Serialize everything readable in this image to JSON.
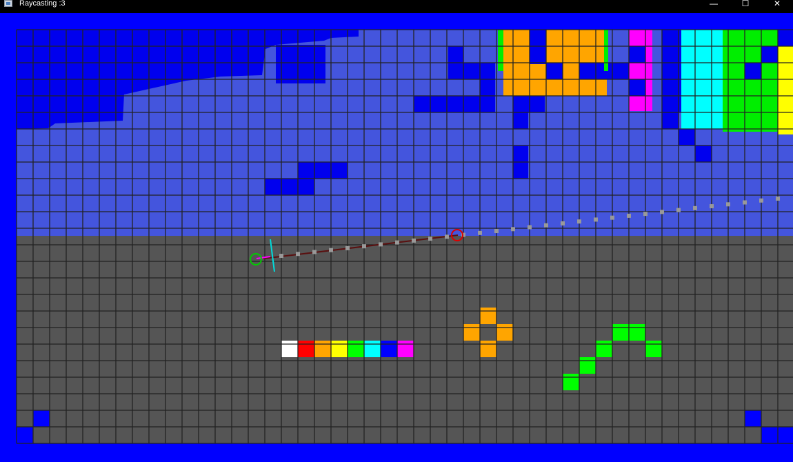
{
  "window": {
    "title": "Raycasting :3",
    "minimize_glyph": "—",
    "maximize_glyph": "☐",
    "close_glyph": "✕"
  },
  "icons": {
    "app": "app-window-icon",
    "minimize": "minimize-icon",
    "maximize": "maximize-icon",
    "close": "close-icon"
  },
  "colors": {
    "wall_blue": "#0000ff",
    "ceiling": "#4455dd",
    "floor": "#555555",
    "grid": "#222222",
    "white": "#ffffff",
    "red": "#ff0000",
    "orange": "#ffa500",
    "yellow": "#ffff00",
    "green": "#00ff00",
    "cyan": "#00ffff",
    "magenta": "#ff00ff",
    "player_circle": "#00cc00",
    "hit_circle": "#dd0000",
    "ray": "#5a1010",
    "ray_dots": "#999999",
    "view_plane": "#00dddd"
  }
}
